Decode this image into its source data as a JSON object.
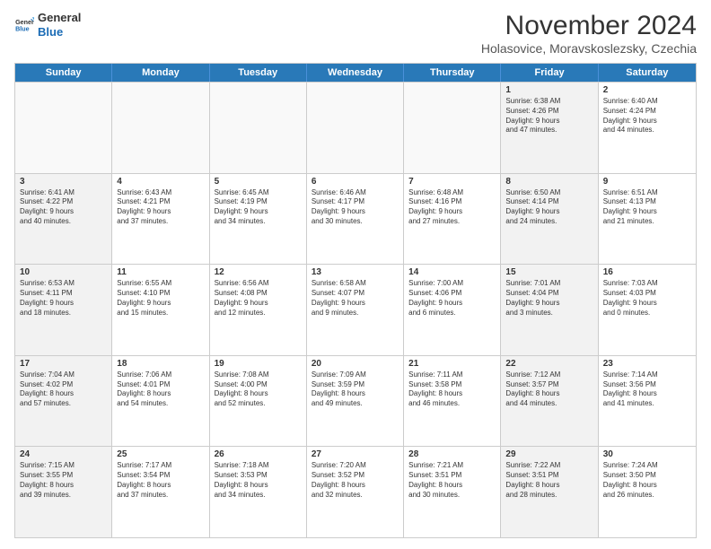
{
  "logo": {
    "line1": "General",
    "line2": "Blue"
  },
  "title": "November 2024",
  "subtitle": "Holasovice, Moravskoslezsky, Czechia",
  "header_days": [
    "Sunday",
    "Monday",
    "Tuesday",
    "Wednesday",
    "Thursday",
    "Friday",
    "Saturday"
  ],
  "rows": [
    [
      {
        "day": "",
        "info": "",
        "empty": true
      },
      {
        "day": "",
        "info": "",
        "empty": true
      },
      {
        "day": "",
        "info": "",
        "empty": true
      },
      {
        "day": "",
        "info": "",
        "empty": true
      },
      {
        "day": "",
        "info": "",
        "empty": true
      },
      {
        "day": "1",
        "info": "Sunrise: 6:38 AM\nSunset: 4:26 PM\nDaylight: 9 hours\nand 47 minutes.",
        "shaded": true
      },
      {
        "day": "2",
        "info": "Sunrise: 6:40 AM\nSunset: 4:24 PM\nDaylight: 9 hours\nand 44 minutes."
      }
    ],
    [
      {
        "day": "3",
        "info": "Sunrise: 6:41 AM\nSunset: 4:22 PM\nDaylight: 9 hours\nand 40 minutes.",
        "shaded": true
      },
      {
        "day": "4",
        "info": "Sunrise: 6:43 AM\nSunset: 4:21 PM\nDaylight: 9 hours\nand 37 minutes."
      },
      {
        "day": "5",
        "info": "Sunrise: 6:45 AM\nSunset: 4:19 PM\nDaylight: 9 hours\nand 34 minutes."
      },
      {
        "day": "6",
        "info": "Sunrise: 6:46 AM\nSunset: 4:17 PM\nDaylight: 9 hours\nand 30 minutes."
      },
      {
        "day": "7",
        "info": "Sunrise: 6:48 AM\nSunset: 4:16 PM\nDaylight: 9 hours\nand 27 minutes."
      },
      {
        "day": "8",
        "info": "Sunrise: 6:50 AM\nSunset: 4:14 PM\nDaylight: 9 hours\nand 24 minutes.",
        "shaded": true
      },
      {
        "day": "9",
        "info": "Sunrise: 6:51 AM\nSunset: 4:13 PM\nDaylight: 9 hours\nand 21 minutes."
      }
    ],
    [
      {
        "day": "10",
        "info": "Sunrise: 6:53 AM\nSunset: 4:11 PM\nDaylight: 9 hours\nand 18 minutes.",
        "shaded": true
      },
      {
        "day": "11",
        "info": "Sunrise: 6:55 AM\nSunset: 4:10 PM\nDaylight: 9 hours\nand 15 minutes."
      },
      {
        "day": "12",
        "info": "Sunrise: 6:56 AM\nSunset: 4:08 PM\nDaylight: 9 hours\nand 12 minutes."
      },
      {
        "day": "13",
        "info": "Sunrise: 6:58 AM\nSunset: 4:07 PM\nDaylight: 9 hours\nand 9 minutes."
      },
      {
        "day": "14",
        "info": "Sunrise: 7:00 AM\nSunset: 4:06 PM\nDaylight: 9 hours\nand 6 minutes."
      },
      {
        "day": "15",
        "info": "Sunrise: 7:01 AM\nSunset: 4:04 PM\nDaylight: 9 hours\nand 3 minutes.",
        "shaded": true
      },
      {
        "day": "16",
        "info": "Sunrise: 7:03 AM\nSunset: 4:03 PM\nDaylight: 9 hours\nand 0 minutes."
      }
    ],
    [
      {
        "day": "17",
        "info": "Sunrise: 7:04 AM\nSunset: 4:02 PM\nDaylight: 8 hours\nand 57 minutes.",
        "shaded": true
      },
      {
        "day": "18",
        "info": "Sunrise: 7:06 AM\nSunset: 4:01 PM\nDaylight: 8 hours\nand 54 minutes."
      },
      {
        "day": "19",
        "info": "Sunrise: 7:08 AM\nSunset: 4:00 PM\nDaylight: 8 hours\nand 52 minutes."
      },
      {
        "day": "20",
        "info": "Sunrise: 7:09 AM\nSunset: 3:59 PM\nDaylight: 8 hours\nand 49 minutes."
      },
      {
        "day": "21",
        "info": "Sunrise: 7:11 AM\nSunset: 3:58 PM\nDaylight: 8 hours\nand 46 minutes."
      },
      {
        "day": "22",
        "info": "Sunrise: 7:12 AM\nSunset: 3:57 PM\nDaylight: 8 hours\nand 44 minutes.",
        "shaded": true
      },
      {
        "day": "23",
        "info": "Sunrise: 7:14 AM\nSunset: 3:56 PM\nDaylight: 8 hours\nand 41 minutes."
      }
    ],
    [
      {
        "day": "24",
        "info": "Sunrise: 7:15 AM\nSunset: 3:55 PM\nDaylight: 8 hours\nand 39 minutes.",
        "shaded": true
      },
      {
        "day": "25",
        "info": "Sunrise: 7:17 AM\nSunset: 3:54 PM\nDaylight: 8 hours\nand 37 minutes."
      },
      {
        "day": "26",
        "info": "Sunrise: 7:18 AM\nSunset: 3:53 PM\nDaylight: 8 hours\nand 34 minutes."
      },
      {
        "day": "27",
        "info": "Sunrise: 7:20 AM\nSunset: 3:52 PM\nDaylight: 8 hours\nand 32 minutes."
      },
      {
        "day": "28",
        "info": "Sunrise: 7:21 AM\nSunset: 3:51 PM\nDaylight: 8 hours\nand 30 minutes."
      },
      {
        "day": "29",
        "info": "Sunrise: 7:22 AM\nSunset: 3:51 PM\nDaylight: 8 hours\nand 28 minutes.",
        "shaded": true
      },
      {
        "day": "30",
        "info": "Sunrise: 7:24 AM\nSunset: 3:50 PM\nDaylight: 8 hours\nand 26 minutes."
      }
    ]
  ]
}
